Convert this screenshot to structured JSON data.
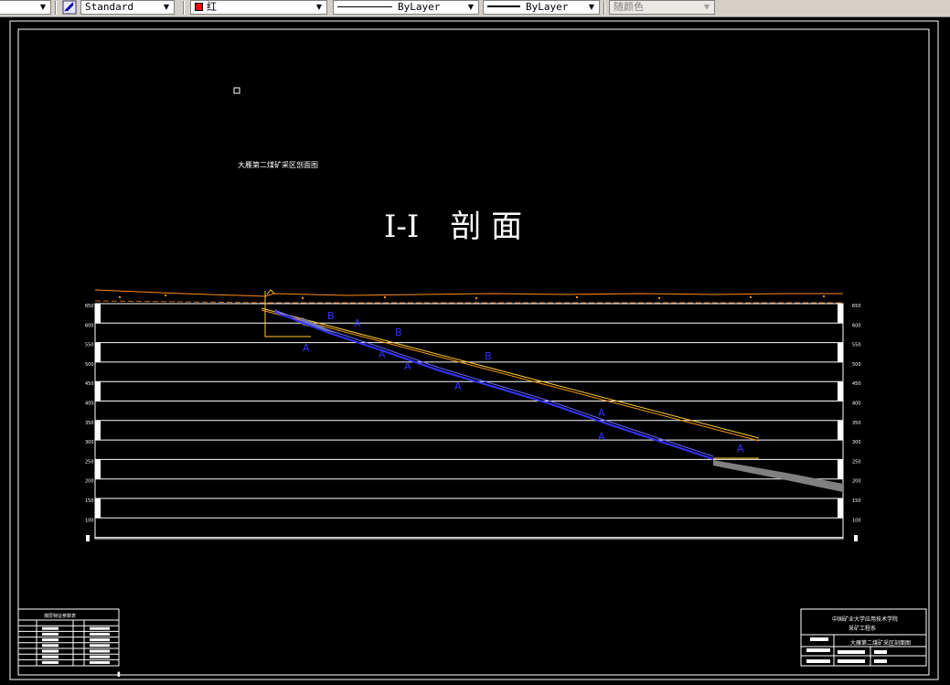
{
  "toolbar": {
    "textstyle_value": "Standard",
    "color_value": "红",
    "color_hex": "#ff0000",
    "linetype_value": "ByLayer",
    "lineweight_value": "ByLayer",
    "plotstyle_value": "随颜色"
  },
  "drawing": {
    "subtitle": "大雁第二煤矿采区剖面图",
    "title": "I-I　剖 面",
    "left_labels": [
      "650",
      "600",
      "550",
      "500",
      "450",
      "400",
      "350",
      "300",
      "250",
      "200",
      "150",
      "100"
    ],
    "right_labels": [
      "650",
      "600",
      "550",
      "500",
      "450",
      "400",
      "350",
      "300",
      "250",
      "200",
      "150",
      "100"
    ],
    "seam_labels": [
      "A",
      "B",
      "A",
      "A",
      "B",
      "A",
      "B",
      "A",
      "A",
      "A",
      "A"
    ],
    "titleblock_org": "中国矿业大学应用技术学院",
    "titleblock_dept": "采矿工程系",
    "titleblock_drawing": "大雁第二煤矿采区剖面图",
    "legend_title": "煤层特征参数表"
  },
  "colors": {
    "background": "#000000",
    "frame": "#ffffff",
    "terrain": "#ff8c1a",
    "seam": "#3333ff",
    "roadway": "#ffcc33",
    "rock": "#808080"
  }
}
